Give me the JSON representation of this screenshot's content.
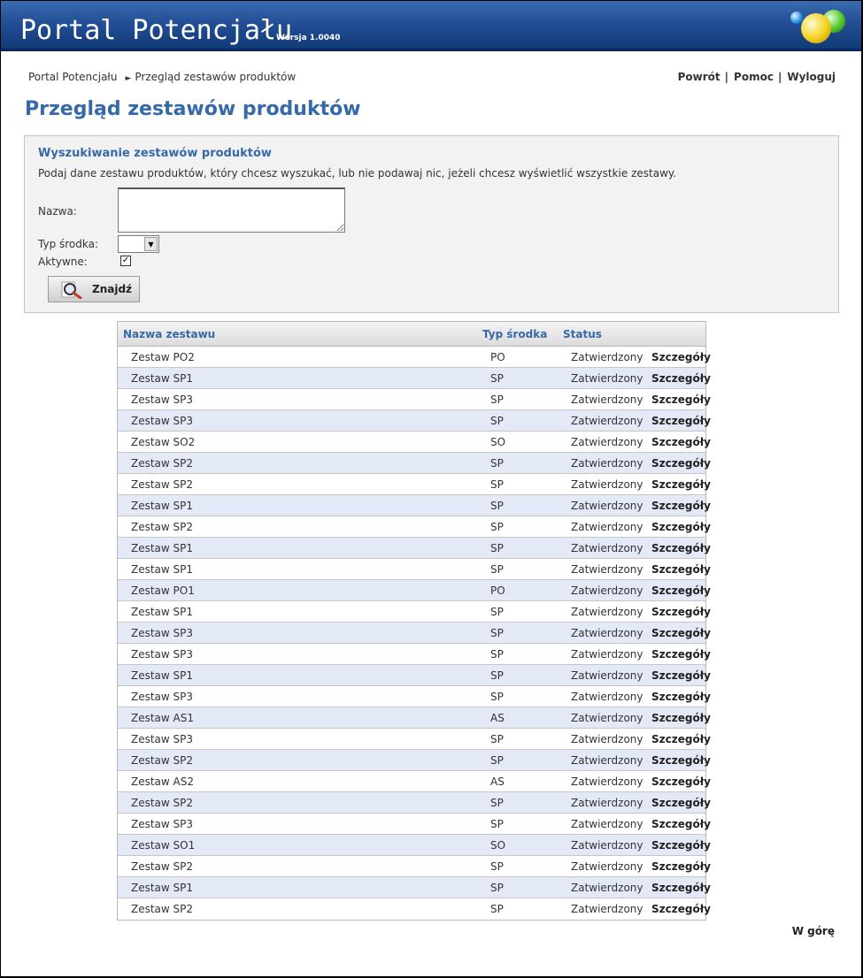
{
  "header": {
    "app_title": "Portal Potencjału",
    "version": "Wersja 1.0040",
    "logo_icon": "colored-balls-logo"
  },
  "breadcrumb": {
    "home": "Portal Potencjału",
    "separator": "►",
    "current": "Przegląd zestawów produktów"
  },
  "toplinks": {
    "back": "Powrót",
    "help": "Pomoc",
    "logout": "Wyloguj",
    "separator": "|"
  },
  "page_title": "Przegląd zestawów produktów",
  "search": {
    "title": "Wyszukiwanie zestawów produktów",
    "description": "Podaj dane zestawu produktów, który chcesz wyszukać, lub nie podawaj nic, jeżeli chcesz wyświetlić wszystkie zestawy.",
    "name_label": "Nazwa:",
    "name_value": "",
    "type_label": "Typ środka:",
    "type_value": "",
    "active_label": "Aktywne:",
    "active_checked": true,
    "find_button": "Znajdź"
  },
  "table": {
    "headers": [
      "Nazwa zestawu",
      "Typ środka",
      "Status"
    ],
    "link_label": "Szczegóły",
    "rows": [
      {
        "name": "Zestaw PO2",
        "type": "PO",
        "status": "Zatwierdzony"
      },
      {
        "name": "Zestaw SP1",
        "type": "SP",
        "status": "Zatwierdzony"
      },
      {
        "name": "Zestaw SP3",
        "type": "SP",
        "status": "Zatwierdzony"
      },
      {
        "name": "Zestaw SP3",
        "type": "SP",
        "status": "Zatwierdzony"
      },
      {
        "name": "Zestaw SO2",
        "type": "SO",
        "status": "Zatwierdzony"
      },
      {
        "name": "Zestaw SP2",
        "type": "SP",
        "status": "Zatwierdzony"
      },
      {
        "name": "Zestaw SP2",
        "type": "SP",
        "status": "Zatwierdzony"
      },
      {
        "name": "Zestaw SP1",
        "type": "SP",
        "status": "Zatwierdzony"
      },
      {
        "name": "Zestaw SP2",
        "type": "SP",
        "status": "Zatwierdzony"
      },
      {
        "name": "Zestaw SP1",
        "type": "SP",
        "status": "Zatwierdzony"
      },
      {
        "name": "Zestaw SP1",
        "type": "SP",
        "status": "Zatwierdzony"
      },
      {
        "name": "Zestaw PO1",
        "type": "PO",
        "status": "Zatwierdzony"
      },
      {
        "name": "Zestaw SP1",
        "type": "SP",
        "status": "Zatwierdzony"
      },
      {
        "name": "Zestaw SP3",
        "type": "SP",
        "status": "Zatwierdzony"
      },
      {
        "name": "Zestaw SP3",
        "type": "SP",
        "status": "Zatwierdzony"
      },
      {
        "name": "Zestaw SP1",
        "type": "SP",
        "status": "Zatwierdzony"
      },
      {
        "name": "Zestaw SP3",
        "type": "SP",
        "status": "Zatwierdzony"
      },
      {
        "name": "Zestaw AS1",
        "type": "AS",
        "status": "Zatwierdzony"
      },
      {
        "name": "Zestaw SP3",
        "type": "SP",
        "status": "Zatwierdzony"
      },
      {
        "name": "Zestaw SP2",
        "type": "SP",
        "status": "Zatwierdzony"
      },
      {
        "name": "Zestaw AS2",
        "type": "AS",
        "status": "Zatwierdzony"
      },
      {
        "name": "Zestaw SP2",
        "type": "SP",
        "status": "Zatwierdzony"
      },
      {
        "name": "Zestaw SP3",
        "type": "SP",
        "status": "Zatwierdzony"
      },
      {
        "name": "Zestaw SO1",
        "type": "SO",
        "status": "Zatwierdzony"
      },
      {
        "name": "Zestaw SP2",
        "type": "SP",
        "status": "Zatwierdzony"
      },
      {
        "name": "Zestaw SP1",
        "type": "SP",
        "status": "Zatwierdzony"
      },
      {
        "name": "Zestaw SP2",
        "type": "SP",
        "status": "Zatwierdzony"
      }
    ]
  },
  "footer": {
    "to_top": "W górę"
  },
  "colors": {
    "header_blue": "#224f95",
    "title_blue": "#3669a8",
    "row_alt": "#e4e9f7"
  }
}
